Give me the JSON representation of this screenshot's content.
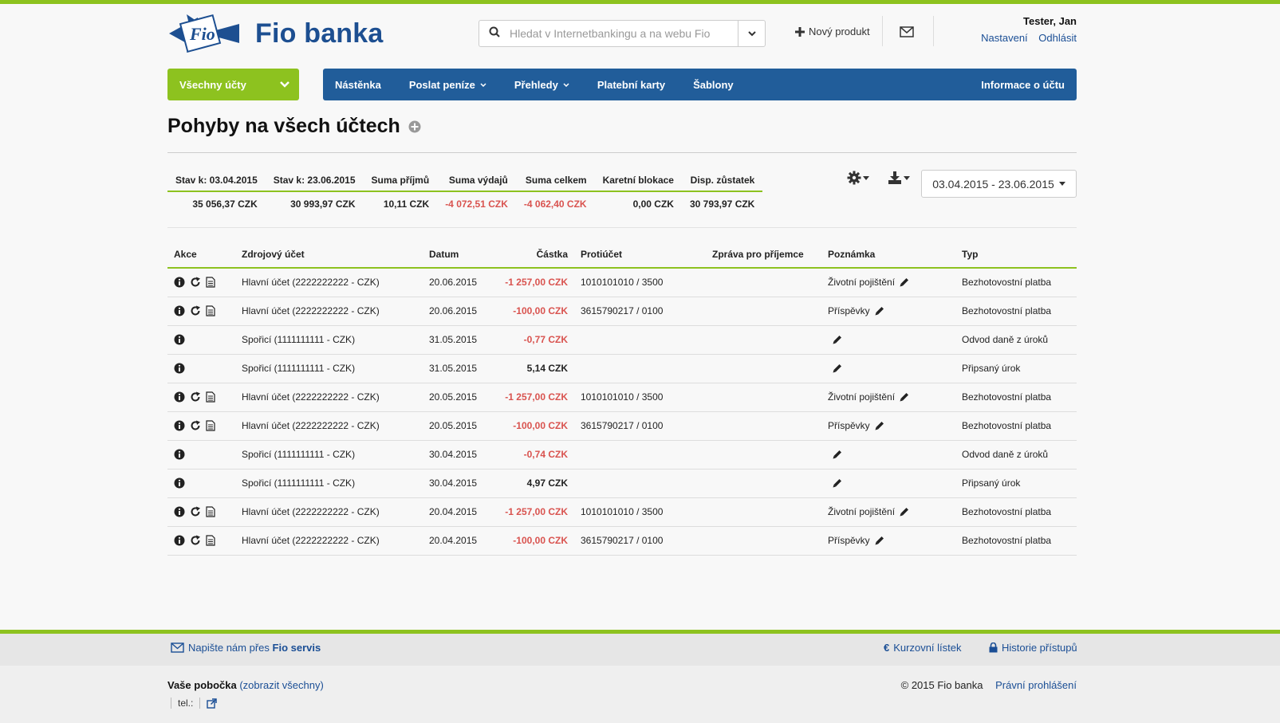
{
  "brand": {
    "logo_text": "Fio",
    "name": "Fio banka"
  },
  "search": {
    "placeholder": "Hledat v Internetbankingu a na webu Fio"
  },
  "header": {
    "new_product": "Nový produkt"
  },
  "user": {
    "name": "Tester, Jan",
    "settings": "Nastavení",
    "logout": "Odhlásit"
  },
  "nav": {
    "all_accounts": "Všechny účty",
    "items": [
      "Nástěnka",
      "Poslat peníze",
      "Přehledy",
      "Platební karty",
      "Šablony"
    ],
    "account_info": "Informace o účtu"
  },
  "page": {
    "title": "Pohyby na všech účtech"
  },
  "summary": {
    "headers": [
      "Stav k: 03.04.2015",
      "Stav k: 23.06.2015",
      "Suma příjmů",
      "Suma výdajů",
      "Suma celkem",
      "Karetní blokace",
      "Disp. zůstatek"
    ],
    "values": [
      "35 056,37 CZK",
      "30 993,97 CZK",
      "10,11 CZK",
      "-4 072,51 CZK",
      "-4 062,40 CZK",
      "0,00 CZK",
      "30 793,97 CZK"
    ]
  },
  "date_range": "03.04.2015 - 23.06.2015",
  "table": {
    "headers": [
      "Akce",
      "Zdrojový účet",
      "Datum",
      "Částka",
      "Protiúčet",
      "Zpráva pro příjemce",
      "Poznámka",
      "Typ"
    ],
    "rows": [
      {
        "account": "Hlavní účet  (2222222222 - CZK)",
        "date": "20.06.2015",
        "amount": "-1 257,00 CZK",
        "counter": "1010101010 / 3500",
        "note": "Životní pojištění",
        "type": "Bezhotovostní platba"
      },
      {
        "account": "Hlavní účet  (2222222222 - CZK)",
        "date": "20.06.2015",
        "amount": "-100,00 CZK",
        "counter": "3615790217 / 0100",
        "note": "Příspěvky",
        "type": "Bezhotovostní platba"
      },
      {
        "account": "Spořicí  (1111111111 - CZK)",
        "date": "31.05.2015",
        "amount": "-0,77 CZK",
        "counter": "",
        "note": "",
        "type": "Odvod daně z úroků"
      },
      {
        "account": "Spořicí  (1111111111 - CZK)",
        "date": "31.05.2015",
        "amount": "5,14 CZK",
        "counter": "",
        "note": "",
        "type": "Připsaný úrok"
      },
      {
        "account": "Hlavní účet  (2222222222 - CZK)",
        "date": "20.05.2015",
        "amount": "-1 257,00 CZK",
        "counter": "1010101010 / 3500",
        "note": "Životní pojištění",
        "type": "Bezhotovostní platba"
      },
      {
        "account": "Hlavní účet  (2222222222 - CZK)",
        "date": "20.05.2015",
        "amount": "-100,00 CZK",
        "counter": "3615790217 / 0100",
        "note": "Příspěvky",
        "type": "Bezhotovostní platba"
      },
      {
        "account": "Spořicí  (1111111111 - CZK)",
        "date": "30.04.2015",
        "amount": "-0,74 CZK",
        "counter": "",
        "note": "",
        "type": "Odvod daně z úroků"
      },
      {
        "account": "Spořicí  (1111111111 - CZK)",
        "date": "30.04.2015",
        "amount": "4,97 CZK",
        "counter": "",
        "note": "",
        "type": "Připsaný úrok"
      },
      {
        "account": "Hlavní účet  (2222222222 - CZK)",
        "date": "20.04.2015",
        "amount": "-1 257,00 CZK",
        "counter": "1010101010 / 3500",
        "note": "Životní pojištění",
        "type": "Bezhotovostní platba"
      },
      {
        "account": "Hlavní účet  (2222222222 - CZK)",
        "date": "20.04.2015",
        "amount": "-100,00 CZK",
        "counter": "3615790217 / 0100",
        "note": "Příspěvky",
        "type": "Bezhotovostní platba"
      }
    ]
  },
  "footer": {
    "write_us": "Napište nám přes",
    "fio_servis": "Fio servis",
    "exchange": "Kurzovní lístek",
    "history": "Historie přístupů",
    "branch": "Vaše pobočka",
    "show_all": "(zobrazit všechny)",
    "tel": "tel.:",
    "copyright": "© 2015 Fio banka",
    "legal": "Právní prohlášení"
  },
  "colors": {
    "green": "#8dc21f",
    "blue": "#215d9a",
    "negative": "#d9534f"
  },
  "icons": [
    "search-icon",
    "chevron-down-icon",
    "plus-icon",
    "envelope-icon",
    "plus-circle-icon",
    "gear-icon",
    "download-icon",
    "info-icon",
    "repeat-icon",
    "document-icon",
    "pencil-icon",
    "euro-icon",
    "lock-icon",
    "external-link-icon"
  ]
}
